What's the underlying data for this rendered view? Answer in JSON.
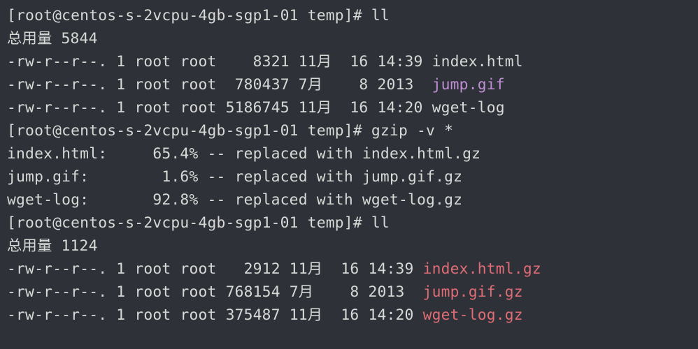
{
  "session": {
    "prompt": "[root@centos-s-2vcpu-4gb-sgp1-01 temp]#",
    "commands": {
      "ll1": "ll",
      "gzip": "gzip -v *",
      "ll2": "ll"
    }
  },
  "ll1": {
    "total_label": "总用量 5844",
    "rows": [
      {
        "perm": "-rw-r--r--.",
        "links": "1",
        "owner": "root",
        "group": "root",
        "size": "   8321",
        "month": "11月",
        "day": " 16",
        "time": "14:39",
        "name": "index.html",
        "class": ""
      },
      {
        "perm": "-rw-r--r--.",
        "links": "1",
        "owner": "root",
        "group": "root",
        "size": " 780437",
        "month": "7月 ",
        "day": "  8",
        "time": "2013 ",
        "name": "jump.gif",
        "class": "file-img"
      },
      {
        "perm": "-rw-r--r--.",
        "links": "1",
        "owner": "root",
        "group": "root",
        "size": "5186745",
        "month": "11月",
        "day": " 16",
        "time": "14:20",
        "name": "wget-log",
        "class": ""
      }
    ]
  },
  "gzip_out": {
    "rows": [
      {
        "name": "index.html:",
        "pad": "     ",
        "ratio": "65.4%",
        "sep": " -- replaced with ",
        "out": "index.html.gz"
      },
      {
        "name": "jump.gif:  ",
        "pad": "      ",
        "ratio": "1.6%",
        "sep": " -- replaced with ",
        "out": "jump.gif.gz"
      },
      {
        "name": "wget-log:  ",
        "pad": "     ",
        "ratio": "92.8%",
        "sep": " -- replaced with ",
        "out": "wget-log.gz"
      }
    ]
  },
  "ll2": {
    "total_label": "总用量 1124",
    "rows": [
      {
        "perm": "-rw-r--r--.",
        "links": "1",
        "owner": "root",
        "group": "root",
        "size": "  2912",
        "month": "11月",
        "day": " 16",
        "time": "14:39",
        "name": "index.html.gz",
        "class": "file-gz"
      },
      {
        "perm": "-rw-r--r--.",
        "links": "1",
        "owner": "root",
        "group": "root",
        "size": "768154",
        "month": "7月 ",
        "day": "  8",
        "time": "2013 ",
        "name": "jump.gif.gz",
        "class": "file-gz"
      },
      {
        "perm": "-rw-r--r--.",
        "links": "1",
        "owner": "root",
        "group": "root",
        "size": "375487",
        "month": "11月",
        "day": " 16",
        "time": "14:20",
        "name": "wget-log.gz",
        "class": "file-gz"
      }
    ]
  }
}
